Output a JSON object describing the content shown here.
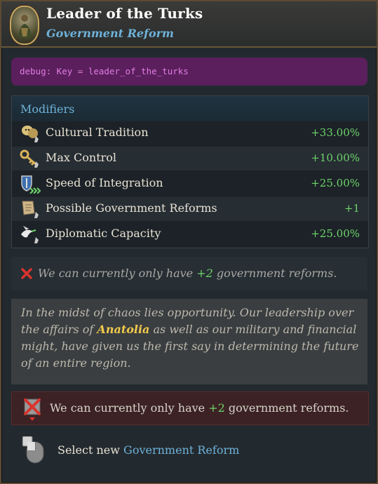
{
  "header": {
    "title": "Leader of the Turks",
    "subtitle": "Government Reform",
    "portrait_icon": "reform-portrait-icon"
  },
  "debug": {
    "text": "debug: Key = leader_of_the_turks"
  },
  "modifiers": {
    "heading": "Modifiers",
    "rows": [
      {
        "icon": "cultural-tradition-icon",
        "label": "Cultural Tradition",
        "value": "+33.00%"
      },
      {
        "icon": "max-control-icon",
        "label": "Max Control",
        "value": "+10.00%"
      },
      {
        "icon": "speed-of-integration-icon",
        "label": "Speed of Integration",
        "value": "+25.00%"
      },
      {
        "icon": "government-reforms-icon",
        "label": "Possible Government Reforms",
        "value": "+1"
      },
      {
        "icon": "diplomatic-capacity-icon",
        "label": "Diplomatic Capacity",
        "value": "+25.00%"
      }
    ]
  },
  "limit_notice": {
    "prefix": "We can currently only have ",
    "count": "+2",
    "suffix": " government reforms."
  },
  "description": {
    "part1": "In the midst of chaos lies opportunity. Our leadership over the affairs of ",
    "highlight": "Anatolia",
    "part2": " as well as our military and financial might, have given us the first say in determining the future of an entire region."
  },
  "blocked_notice": {
    "prefix": "We can currently only have ",
    "count": "+2",
    "suffix": " government reforms."
  },
  "action": {
    "prefix": "Select new ",
    "link": "Government Reform"
  },
  "colors": {
    "accent_blue": "#6eb2d9",
    "positive_green": "#6ed36b",
    "highlight_gold": "#f2c94c",
    "debug_purple": "#5a1f5c"
  }
}
